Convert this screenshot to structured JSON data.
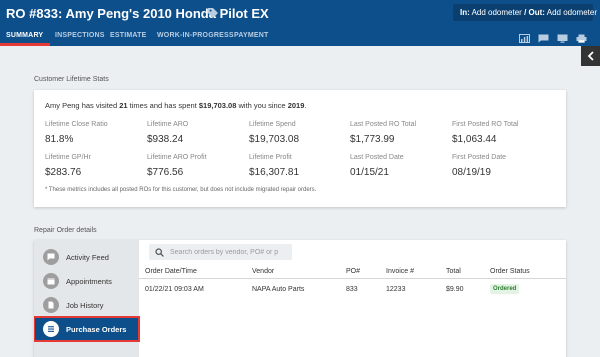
{
  "header": {
    "title": "RO #833: Amy Peng's 2010 Honda Pilot EX",
    "odometer_in_label": "In:",
    "odometer_in_value": "Add odometer",
    "odometer_sep": "/",
    "odometer_out_label": "Out:",
    "odometer_out_value": "Add odometer"
  },
  "tabs": [
    "SUMMARY",
    "INSPECTIONS",
    "ESTIMATE",
    "WORK-IN-PROGRESS",
    "PAYMENT"
  ],
  "toolbar_icons": [
    "chart-icon",
    "message-icon",
    "video-icon",
    "print-icon"
  ],
  "lifetime": {
    "section_title": "Customer Lifetime Stats",
    "summary": {
      "name": "Amy Peng",
      "pre_visits": " has visited ",
      "visits": "21",
      "mid": " times and has spent ",
      "spent": "$19,703.08",
      "pre_year": " with you since ",
      "since": "2019",
      "end": "."
    },
    "stats": [
      {
        "label": "Lifetime Close Ratio",
        "value": "81.8%"
      },
      {
        "label": "Lifetime ARO",
        "value": "$938.24"
      },
      {
        "label": "Lifetime Spend",
        "value": "$19,703.08"
      },
      {
        "label": "Last Posted RO Total",
        "value": "$1,773.99"
      },
      {
        "label": "First Posted RO Total",
        "value": "$1,063.44"
      },
      {
        "label": "Lifetime GP/Hr",
        "value": "$283.76"
      },
      {
        "label": "Lifetime ARO Profit",
        "value": "$776.56"
      },
      {
        "label": "Lifetime Profit",
        "value": "$16,307.81"
      },
      {
        "label": "Last Posted Date",
        "value": "01/15/21"
      },
      {
        "label": "First Posted Date",
        "value": "08/19/19"
      }
    ],
    "footnote": "* These metrics includes all posted ROs for this customer, but does not include migrated repair orders."
  },
  "repair": {
    "section_title": "Repair Order details",
    "nav": [
      {
        "label": "Activity Feed",
        "active": false
      },
      {
        "label": "Appointments",
        "active": false
      },
      {
        "label": "Job History",
        "active": false
      },
      {
        "label": "Purchase Orders",
        "active": true
      }
    ],
    "search_placeholder": "Search orders by vendor, PO# or p",
    "columns": [
      "Order Date/Time",
      "Vendor",
      "PO#",
      "Invoice #",
      "Total",
      "Order Status"
    ],
    "rows": [
      {
        "date": "01/22/21 09:03 AM",
        "vendor": "NAPA Auto Parts",
        "po": "833",
        "invoice": "12233",
        "total": "$9.90",
        "status": "Ordered"
      }
    ]
  },
  "colors": {
    "brand": "#0d4f8b",
    "accent": "#e53935",
    "status_ok": "#2e7d32"
  }
}
